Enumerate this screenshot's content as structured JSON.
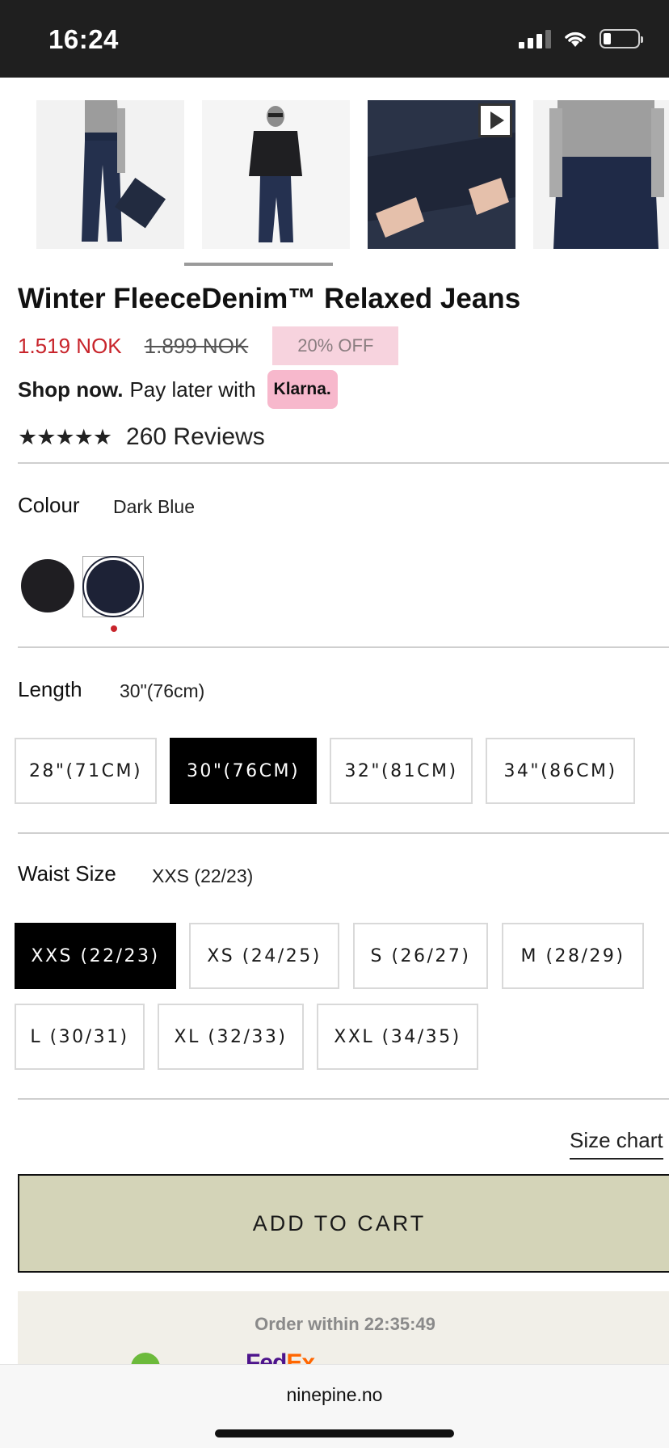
{
  "status_bar": {
    "time": "16:24"
  },
  "gallery": {
    "thumbnails": [
      {
        "icon": "jeans-front-image"
      },
      {
        "icon": "model-winter-outfit-image"
      },
      {
        "icon": "fleece-lining-closeup-image",
        "has_video": true
      },
      {
        "icon": "jeans-waist-detail-image"
      }
    ],
    "active_index": 1
  },
  "product": {
    "title": "Winter FleeceDenim™ Relaxed Jeans",
    "price_sale": "1.519 NOK",
    "price_original": "1.899 NOK",
    "discount": "20% OFF",
    "klarna": {
      "strong": "Shop now.",
      "text": "Pay later with",
      "badge": "Klarna."
    },
    "rating": {
      "stars": "★★★★★",
      "value": 5,
      "reviews": "260 Reviews"
    }
  },
  "colour": {
    "label": "Colour",
    "value": "Dark Blue",
    "swatches": [
      {
        "name": "Black",
        "color": "#1f1e22"
      },
      {
        "name": "Dark Blue",
        "color": "#1d2236",
        "selected": true
      }
    ]
  },
  "length": {
    "label": "Length",
    "value": "30\"(76cm)",
    "options": [
      "28\"(71CM)",
      "30\"(76CM)",
      "32\"(81CM)",
      "34\"(86CM)"
    ],
    "selected_index": 1
  },
  "waist": {
    "label": "Waist Size",
    "value": "XXS (22/23)",
    "options": [
      "XXS (22/23)",
      "XS (24/25)",
      "S (26/27)",
      "M (28/29)",
      "L (30/31)",
      "XL (32/33)",
      "XXL (34/35)"
    ],
    "selected_index": 0
  },
  "actions": {
    "size_chart": "Size chart",
    "add_to_cart": "ADD TO CART"
  },
  "delivery": {
    "order_within": "Order within 22:35:49",
    "carrier_fe": "Fed",
    "carrier_ex": "Ex"
  },
  "browser": {
    "url": "ninepine.no"
  },
  "colors": {
    "sale_price": "#c8242b",
    "discount_badge": "#f7d3de",
    "klarna_pink": "#f7b8cc",
    "add_to_cart_bg": "#d4d4b8",
    "selected_size": "#000000"
  }
}
